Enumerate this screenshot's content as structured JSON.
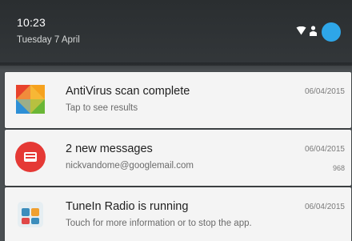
{
  "status": {
    "time": "10:23",
    "date": "Tuesday 7 April",
    "icons": [
      "wifi-icon",
      "person-icon",
      "avatar"
    ]
  },
  "notifications": [
    {
      "app_icon": "avast-antivirus-icon",
      "title": "AntiVirus scan complete",
      "subtitle": "Tap to see results",
      "date": "06/04/2015",
      "count": ""
    },
    {
      "app_icon": "email-icon",
      "title": "2 new messages",
      "subtitle": "nickvandome@googlemail.com",
      "date": "06/04/2015",
      "count": "968"
    },
    {
      "app_icon": "tunein-radio-icon",
      "title": "TuneIn Radio is running",
      "subtitle": "Touch for more information or to stop the app.",
      "date": "06/04/2015",
      "count": ""
    }
  ],
  "colors": {
    "header_bg": "#2f3335",
    "card_bg": "#f4f4f4",
    "email_red": "#e53935",
    "avatar_blue": "#2ea6e8"
  }
}
